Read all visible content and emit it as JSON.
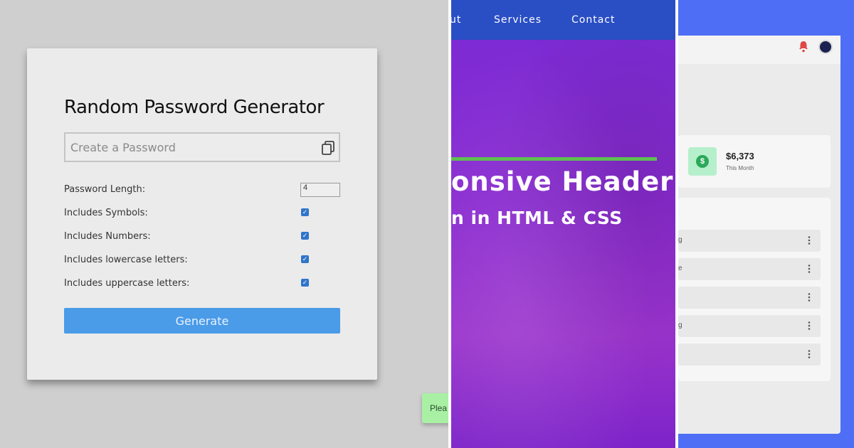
{
  "password_generator": {
    "title": "Random Password Generator",
    "input_placeholder": "Create a Password",
    "copy_icon": "copy-icon",
    "options": [
      {
        "label": "Password Length:",
        "type": "number",
        "value": "4"
      },
      {
        "label": "Includes Symbols:",
        "type": "checkbox",
        "checked": true
      },
      {
        "label": "Includes Numbers:",
        "type": "checkbox",
        "checked": true
      },
      {
        "label": "Includes lowercase letters:",
        "type": "checkbox",
        "checked": true
      },
      {
        "label": "Includes uppercase letters:",
        "type": "checkbox",
        "checked": true
      }
    ],
    "button_label": "Generate",
    "toast_text": "Plea",
    "colors": {
      "button": "#4a9be8",
      "toast": "#a9f0a5",
      "background": "#cfcfcf"
    }
  },
  "responsive_header": {
    "nav_items": [
      "ut",
      "Services",
      "Contact"
    ],
    "hero_title": "onsive Header",
    "hero_subtitle": "n in HTML & CSS",
    "colors": {
      "nav_bar": "#2a4ec4",
      "accent_line": "#5fbf52",
      "hero_bg": "#8a2bd0"
    }
  },
  "dashboard": {
    "icons": [
      "bell-icon",
      "avatar"
    ],
    "stat": {
      "icon": "dollar-icon",
      "value": "$6,373",
      "caption": "This Month"
    },
    "list_rows": [
      {
        "text": "g",
        "icon": "kebab-menu-icon"
      },
      {
        "text": "e",
        "icon": "kebab-menu-icon"
      },
      {
        "text": "",
        "icon": "kebab-menu-icon"
      },
      {
        "text": "g",
        "icon": "kebab-menu-icon"
      },
      {
        "text": "",
        "icon": "kebab-menu-icon"
      }
    ],
    "colors": {
      "background": "#4d6ef5",
      "stat_icon_bg": "#b6efcb",
      "stat_icon": "#2aa95a"
    }
  }
}
